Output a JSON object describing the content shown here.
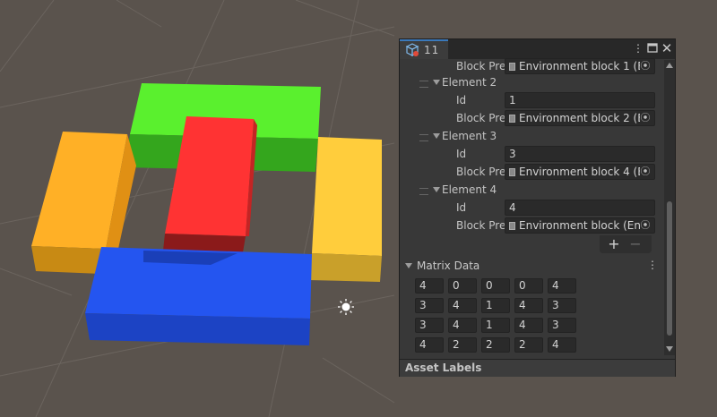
{
  "scene": {
    "colors": {
      "background": "#5a534d",
      "grid": "#6b645e",
      "green_top": "#5af02e",
      "green_side": "#34a61d",
      "red_top": "#ff3333",
      "red_side": "#8b1a1a",
      "orange": "#ffb026",
      "yellow": "#ffcd3c",
      "blue": "#2455f0"
    },
    "icons": [
      "sun-icon"
    ]
  },
  "inspector": {
    "tab_label": "11",
    "tab_icon": "cube-icon",
    "window_buttons": [
      "more-vertical-icon",
      "maximize-icon",
      "close-icon"
    ],
    "elements": [
      {
        "block_label": "Block Pre",
        "block_value": "Environment block 1 (En"
      },
      {
        "header": "Element 2",
        "id_label": "Id",
        "id_value": "1",
        "block_label": "Block Pre",
        "block_value": "Environment block 2 (En"
      },
      {
        "header": "Element 3",
        "id_label": "Id",
        "id_value": "3",
        "block_label": "Block Pre",
        "block_value": "Environment block 4 (En"
      },
      {
        "header": "Element 4",
        "id_label": "Id",
        "id_value": "4",
        "block_label": "Block Pre",
        "block_value": "Environment block (Env"
      }
    ],
    "add_label": "+",
    "remove_label": "−",
    "matrix": {
      "title": "Matrix Data",
      "rows": [
        [
          "4",
          "0",
          "0",
          "0",
          "4"
        ],
        [
          "3",
          "4",
          "1",
          "4",
          "3"
        ],
        [
          "3",
          "4",
          "1",
          "4",
          "3"
        ],
        [
          "4",
          "2",
          "2",
          "2",
          "4"
        ]
      ]
    },
    "footer": "Asset Labels"
  }
}
